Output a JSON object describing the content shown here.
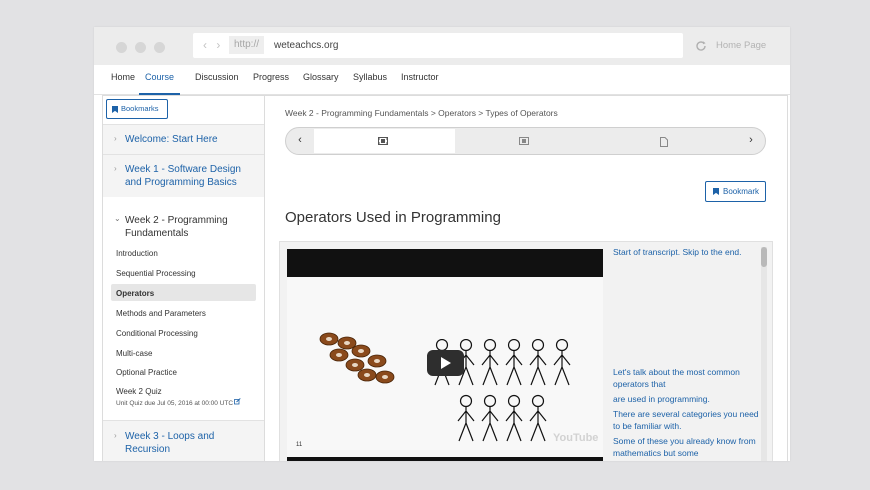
{
  "browser": {
    "nav_arrows": "‹ ›",
    "protocol": "http://",
    "domain": "weteachcs.org",
    "home_page": "Home Page"
  },
  "topnav": [
    "Home",
    "Course",
    "Discussion",
    "Progress",
    "Glossary",
    "Syllabus",
    "Instructor"
  ],
  "topnav_active": "Course",
  "sidebar": {
    "bookmarks_label": "Bookmarks",
    "sections": [
      {
        "title": "Welcome: Start Here"
      },
      {
        "title": "Week 1 - Software Design and Programming Basics"
      },
      {
        "title": "Week 2 - Programming Fundamentals"
      },
      {
        "title": "Week 3 - Loops and Recursion"
      }
    ],
    "week2_items": [
      "Introduction",
      "Sequential Processing",
      "Operators",
      "Methods and Parameters",
      "Conditional Processing",
      "Multi-case",
      "Optional Practice",
      "Week 2 Quiz"
    ],
    "active_item": "Operators",
    "quiz_due": "Unit Quiz due Jul 05, 2016 at 00:00 UTC"
  },
  "main": {
    "breadcrumb": "Week 2 - Programming Fundamentals > Operators > Types of Operators",
    "sequence_icons": [
      "video-icon",
      "video-icon",
      "document-icon"
    ],
    "bookmark_label": "Bookmark",
    "unit_title": "Operators Used in Programming",
    "video": {
      "time": "11",
      "watermark": "YouTube"
    },
    "transcript": [
      "Start of transcript. Skip to the end.",
      "Let's talk about the most common operators that",
      "are used in programming.",
      "There are several categories you need to be familiar with.",
      "Some of these you already know from mathematics but some"
    ]
  },
  "colors": {
    "accent": "#1d62a8",
    "sidebar_header_bg": "#f4f4f4",
    "active_item_bg": "#e6e6e6"
  }
}
